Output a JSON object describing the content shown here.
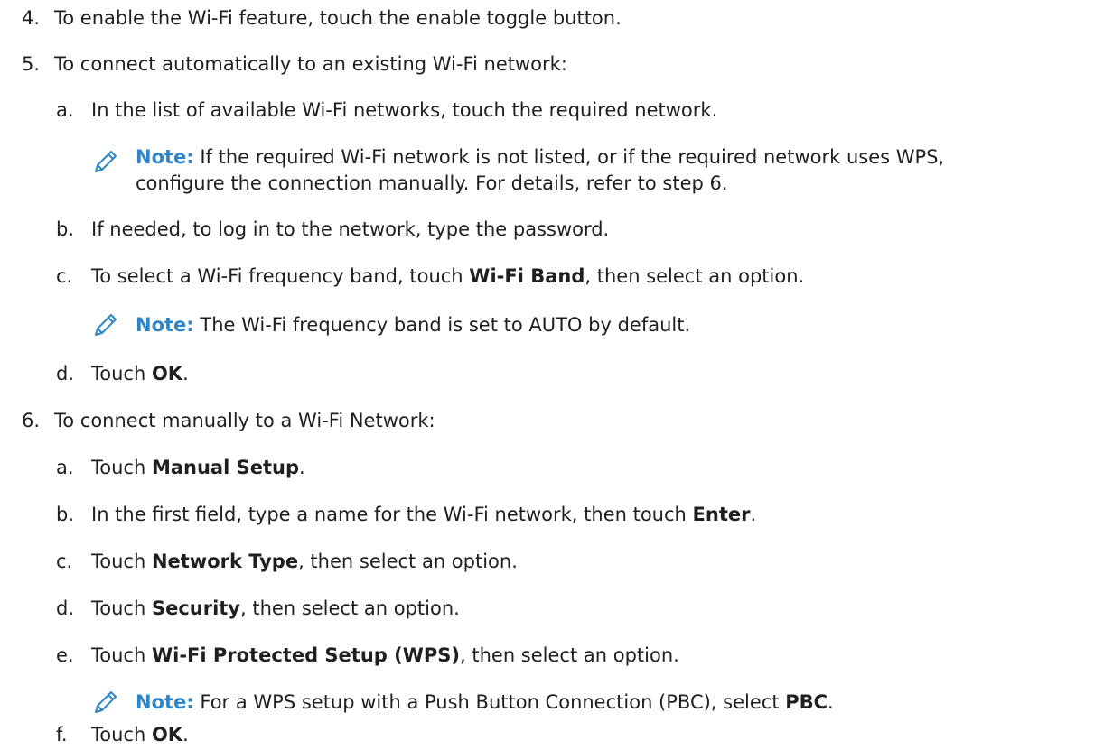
{
  "steps": {
    "s4": {
      "num": "4.",
      "text": "To enable the Wi-Fi feature, touch the enable toggle button."
    },
    "s5": {
      "num": "5.",
      "text": "To connect automatically to an existing Wi-Fi network:",
      "a": {
        "num": "a.",
        "text": "In the list of available Wi-Fi networks, touch the required network."
      },
      "note_a": {
        "label": "Note:",
        "line1": " If the required Wi-Fi network is not listed, or if the required network uses WPS,",
        "line2": "configure the connection manually. For details, refer to step 6."
      },
      "b": {
        "num": "b.",
        "text": "If needed, to log in to the network, type the password."
      },
      "c": {
        "num": "c.",
        "pre": "To select a Wi-Fi frequency band, touch ",
        "bold": "Wi-Fi Band",
        "post": ", then select an option."
      },
      "note_c": {
        "label": "Note:",
        "text": " The Wi-Fi frequency band is set to AUTO by default."
      },
      "d": {
        "num": "d.",
        "pre": "Touch ",
        "bold": "OK",
        "post": "."
      }
    },
    "s6": {
      "num": "6.",
      "text": "To connect manually to a Wi-Fi Network:",
      "a": {
        "num": "a.",
        "pre": "Touch ",
        "bold": "Manual Setup",
        "post": "."
      },
      "b": {
        "num": "b.",
        "pre": "In the first field, type a name for the Wi-Fi network, then touch ",
        "bold": "Enter",
        "post": "."
      },
      "c": {
        "num": "c.",
        "pre": "Touch ",
        "bold": "Network Type",
        "post": ", then select an option."
      },
      "d": {
        "num": "d.",
        "pre": "Touch ",
        "bold": "Security",
        "post": ", then select an option."
      },
      "e": {
        "num": "e.",
        "pre": "Touch ",
        "bold": "Wi-Fi Protected Setup (WPS)",
        "post": ", then select an option."
      },
      "note_e": {
        "label": "Note:",
        "pre": " For a WPS setup with a Push Button Connection (PBC), select ",
        "bold": "PBC",
        "post": "."
      },
      "f": {
        "num": "f.",
        "pre": "Touch ",
        "bold": "OK",
        "post": "."
      }
    }
  },
  "icons": {
    "note": "pencil-icon"
  },
  "colors": {
    "note_label": "#2e86c8",
    "icon": "#2e86c8",
    "text": "#1f1f1f"
  }
}
